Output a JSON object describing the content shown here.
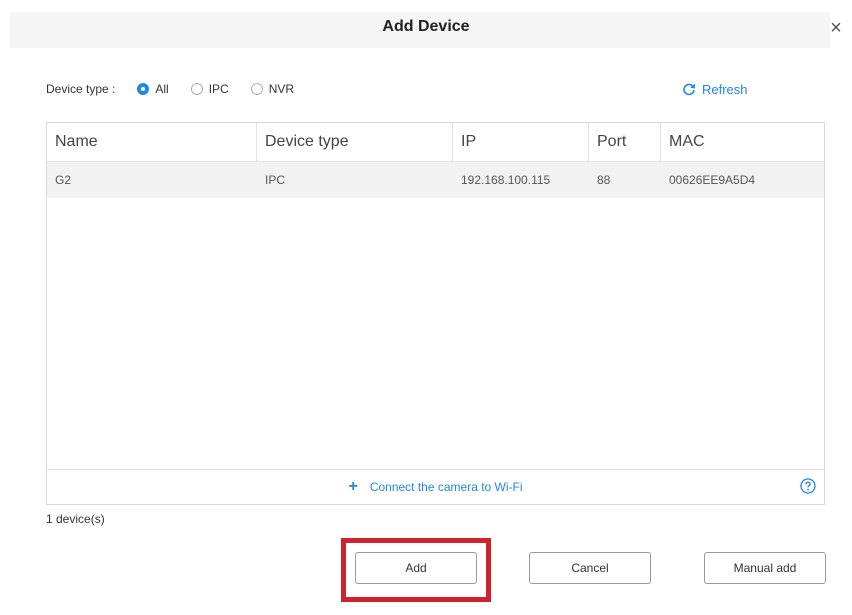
{
  "dialog": {
    "title": "Add Device",
    "close_glyph": "×"
  },
  "filter": {
    "label": "Device type :",
    "options": [
      {
        "label": "All",
        "checked": true
      },
      {
        "label": "IPC",
        "checked": false
      },
      {
        "label": "NVR",
        "checked": false
      }
    ],
    "refresh_label": "Refresh"
  },
  "table": {
    "columns": [
      "Name",
      "Device type",
      "IP",
      "Port",
      "MAC"
    ],
    "rows": [
      {
        "name": "G2",
        "device_type": "IPC",
        "ip": "192.168.100.115",
        "port": "88",
        "mac": "00626EE9A5D4"
      }
    ],
    "footer_link": "Connect the camera to Wi-Fi"
  },
  "summary": {
    "count_label": "1 device(s)"
  },
  "buttons": {
    "add": "Add",
    "cancel": "Cancel",
    "manual_add": "Manual add"
  },
  "colors": {
    "accent": "#1e88e5",
    "highlight": "#d0222a"
  },
  "icons": {
    "refresh": "refresh-icon",
    "plus": "plus-icon",
    "help": "help-icon",
    "close": "close-icon"
  }
}
